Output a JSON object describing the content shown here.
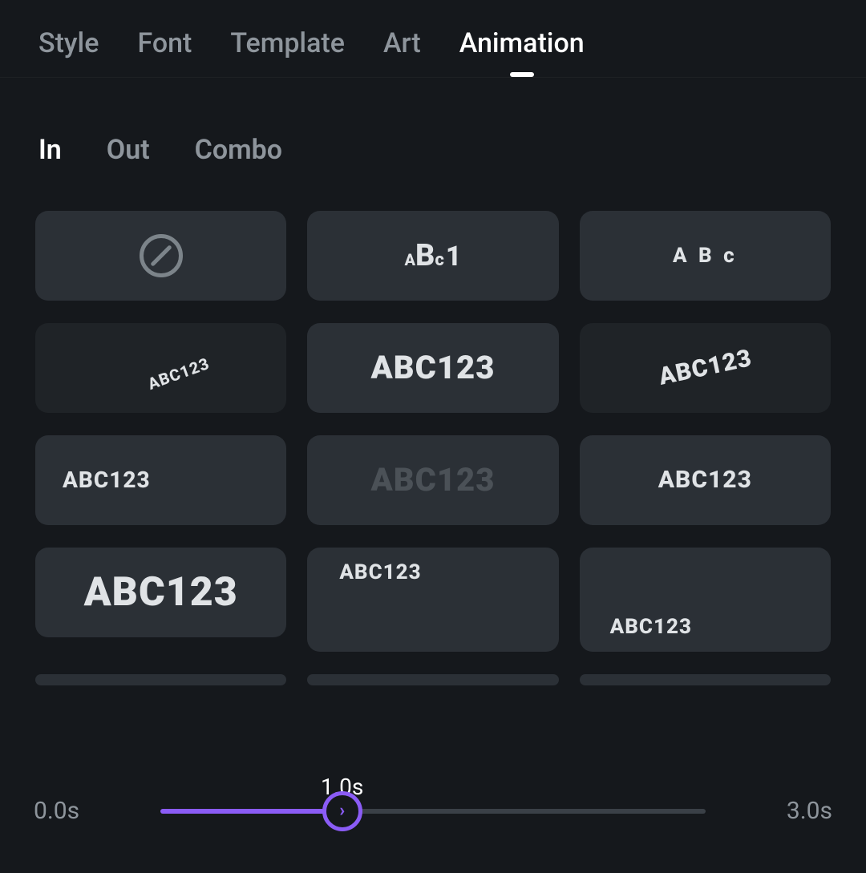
{
  "topTabs": {
    "items": [
      {
        "label": "Style"
      },
      {
        "label": "Font"
      },
      {
        "label": "Template"
      },
      {
        "label": "Art"
      },
      {
        "label": "Animation"
      }
    ],
    "activeIndex": 4
  },
  "subTabs": {
    "items": [
      {
        "label": "In"
      },
      {
        "label": "Out"
      },
      {
        "label": "Combo"
      }
    ],
    "activeIndex": 0
  },
  "presets": [
    {
      "kind": "none"
    },
    {
      "kind": "abc1",
      "text": "ABc1"
    },
    {
      "kind": "text",
      "text": "A B c"
    },
    {
      "kind": "text",
      "text": "ABC123"
    },
    {
      "kind": "text",
      "text": "ABC123"
    },
    {
      "kind": "text",
      "text": "ABC123"
    },
    {
      "kind": "text",
      "text": "ABC123"
    },
    {
      "kind": "text",
      "text": "ABC123"
    },
    {
      "kind": "text",
      "text": "ABC123"
    },
    {
      "kind": "text",
      "text": "ABC123"
    },
    {
      "kind": "text",
      "text": "ABC123"
    },
    {
      "kind": "text",
      "text": "ABC123"
    }
  ],
  "slider": {
    "min": 0.0,
    "max": 3.0,
    "value": 1.0,
    "minLabel": "0.0s",
    "maxLabel": "3.0s",
    "valueLabel": "1.0s",
    "thumbGlyph": "›"
  },
  "colors": {
    "accent": "#8b5cf6"
  }
}
